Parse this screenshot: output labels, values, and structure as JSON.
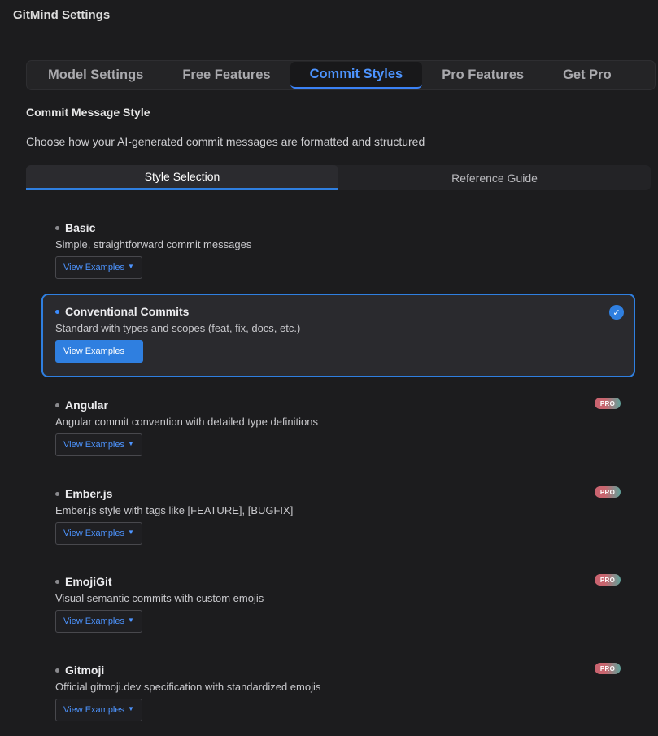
{
  "app": {
    "title": "GitMind Settings"
  },
  "tabs": [
    {
      "label": "Model Settings",
      "active": false
    },
    {
      "label": "Free Features",
      "active": false
    },
    {
      "label": "Commit Styles",
      "active": true
    },
    {
      "label": "Pro Features",
      "active": false
    },
    {
      "label": "Get Pro",
      "active": false
    }
  ],
  "section": {
    "title": "Commit Message Style",
    "description": "Choose how your AI-generated commit messages are formatted and structured"
  },
  "subtabs": [
    {
      "label": "Style Selection",
      "active": true
    },
    {
      "label": "Reference Guide",
      "active": false
    }
  ],
  "styles": [
    {
      "name": "Basic",
      "description": "Simple, straightforward commit messages",
      "button": "View Examples",
      "selected": false,
      "pro": false
    },
    {
      "name": "Conventional Commits",
      "description": "Standard with types and scopes (feat, fix, docs, etc.)",
      "button": "View Examples",
      "selected": true,
      "pro": false
    },
    {
      "name": "Angular",
      "description": "Angular commit convention with detailed type definitions",
      "button": "View Examples",
      "selected": false,
      "pro": true,
      "badge": "PRO"
    },
    {
      "name": "Ember.js",
      "description": "Ember.js style with tags like [FEATURE], [BUGFIX]",
      "button": "View Examples",
      "selected": false,
      "pro": true,
      "badge": "PRO"
    },
    {
      "name": "EmojiGit",
      "description": "Visual semantic commits with custom emojis",
      "button": "View Examples",
      "selected": false,
      "pro": true,
      "badge": "PRO"
    },
    {
      "name": "Gitmoji",
      "description": "Official gitmoji.dev specification with standardized emojis",
      "button": "View Examples",
      "selected": false,
      "pro": true,
      "badge": "PRO"
    }
  ],
  "icons": {
    "caret": "chevron-down-icon",
    "check": "checkmark-icon",
    "bullet": "dot-icon"
  },
  "colors": {
    "accent": "#2f7fe0",
    "background": "#1c1c1e",
    "link": "#4d94ff"
  }
}
